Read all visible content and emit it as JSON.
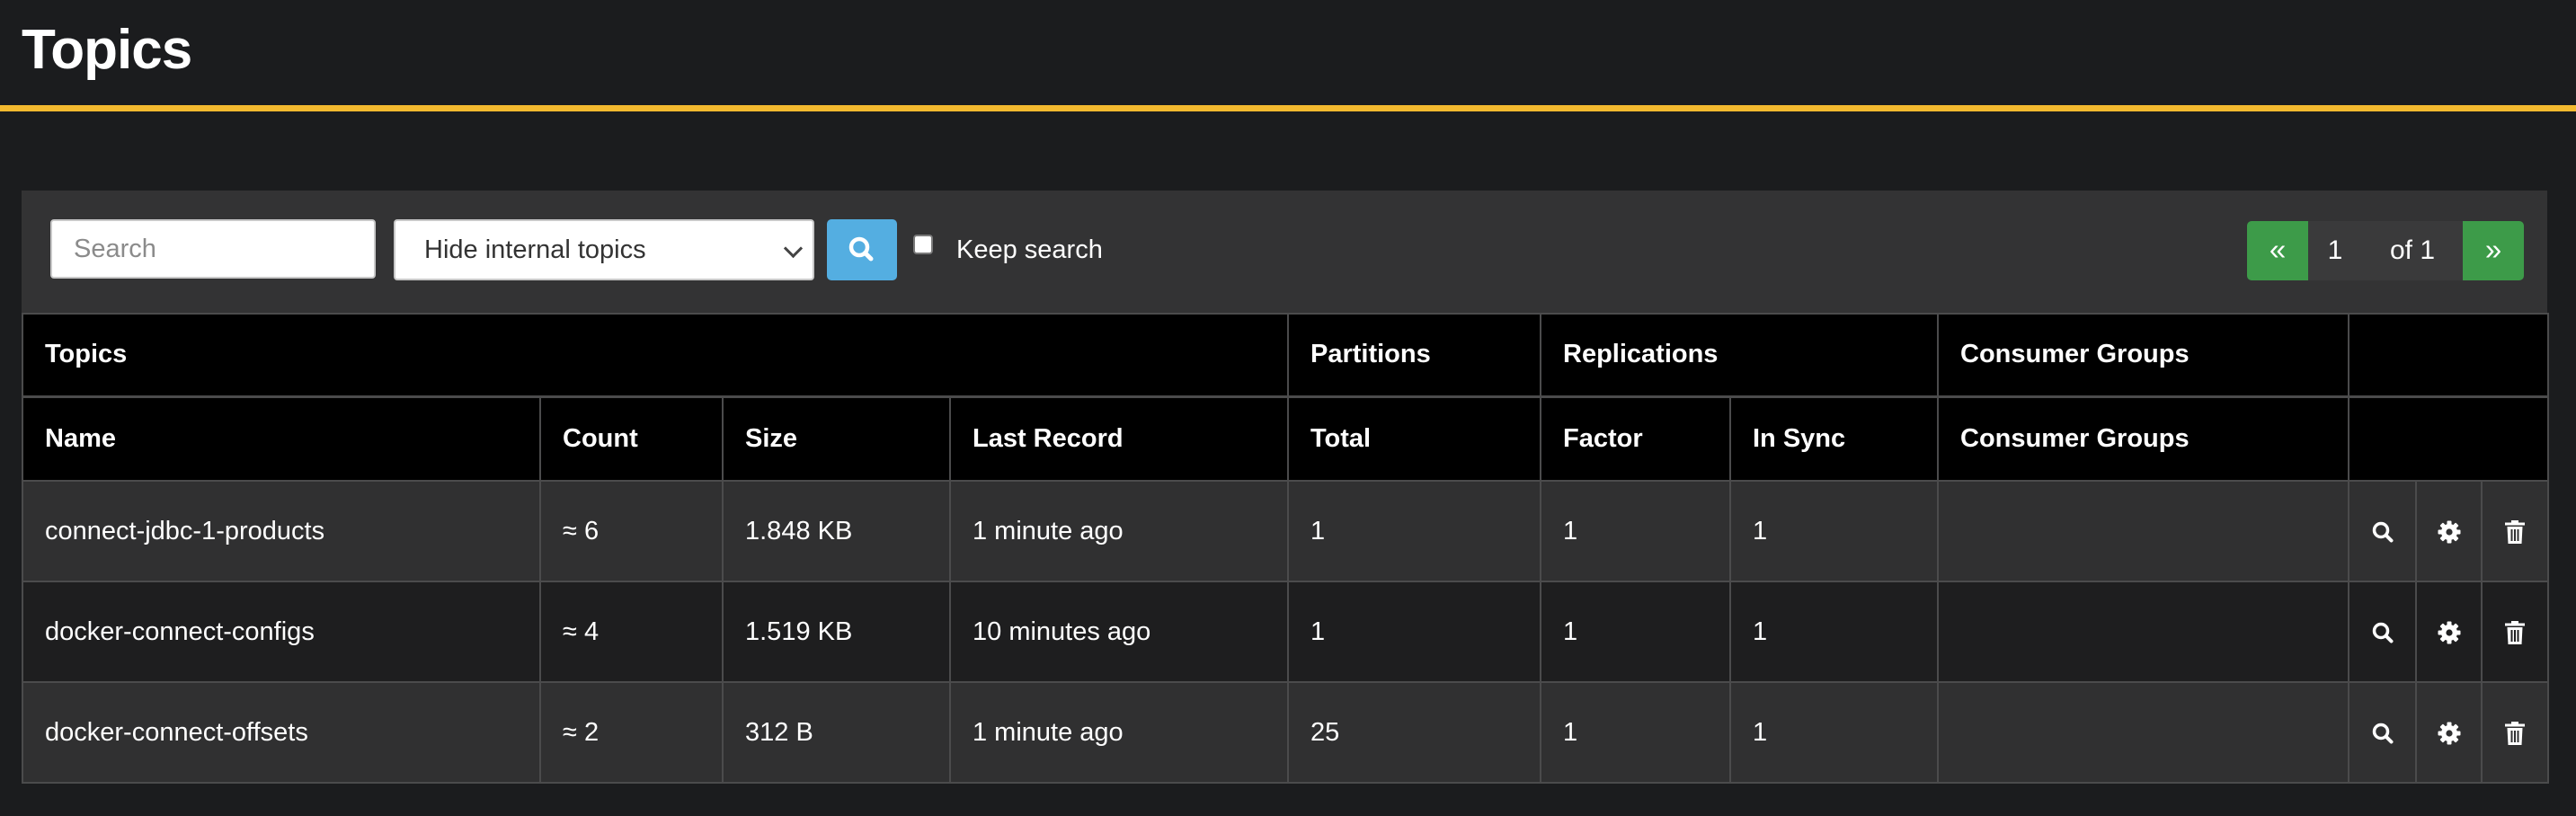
{
  "page": {
    "title": "Topics"
  },
  "colors": {
    "accent": "#f3b92f",
    "search_button": "#54aee1",
    "pager_button": "#3d9b49"
  },
  "toolbar": {
    "search_placeholder": "Search",
    "search_value": "",
    "filter_selected": "Hide internal topics",
    "search_icon": "search-icon",
    "keep_search_label": "Keep search",
    "keep_search_checked": false
  },
  "pager": {
    "prev": "«",
    "page": "1",
    "of": "of 1",
    "next": "»"
  },
  "table": {
    "group_headers": [
      "Topics",
      "Partitions",
      "Replications",
      "Consumer Groups",
      ""
    ],
    "column_headers": [
      "Name",
      "Count",
      "Size",
      "Last Record",
      "Total",
      "Factor",
      "In Sync",
      "Consumer Groups"
    ],
    "row_action_icons": [
      "search-icon",
      "gear-icon",
      "trash-icon"
    ],
    "rows": [
      {
        "name": "connect-jdbc-1-products",
        "count": "≈ 6",
        "size": "1.848 KB",
        "last_record": "1 minute ago",
        "total": "1",
        "factor": "1",
        "in_sync": "1",
        "consumer_groups": ""
      },
      {
        "name": "docker-connect-configs",
        "count": "≈ 4",
        "size": "1.519 KB",
        "last_record": "10 minutes ago",
        "total": "1",
        "factor": "1",
        "in_sync": "1",
        "consumer_groups": ""
      },
      {
        "name": "docker-connect-offsets",
        "count": "≈ 2",
        "size": "312 B",
        "last_record": "1 minute ago",
        "total": "25",
        "factor": "1",
        "in_sync": "1",
        "consumer_groups": ""
      }
    ]
  }
}
